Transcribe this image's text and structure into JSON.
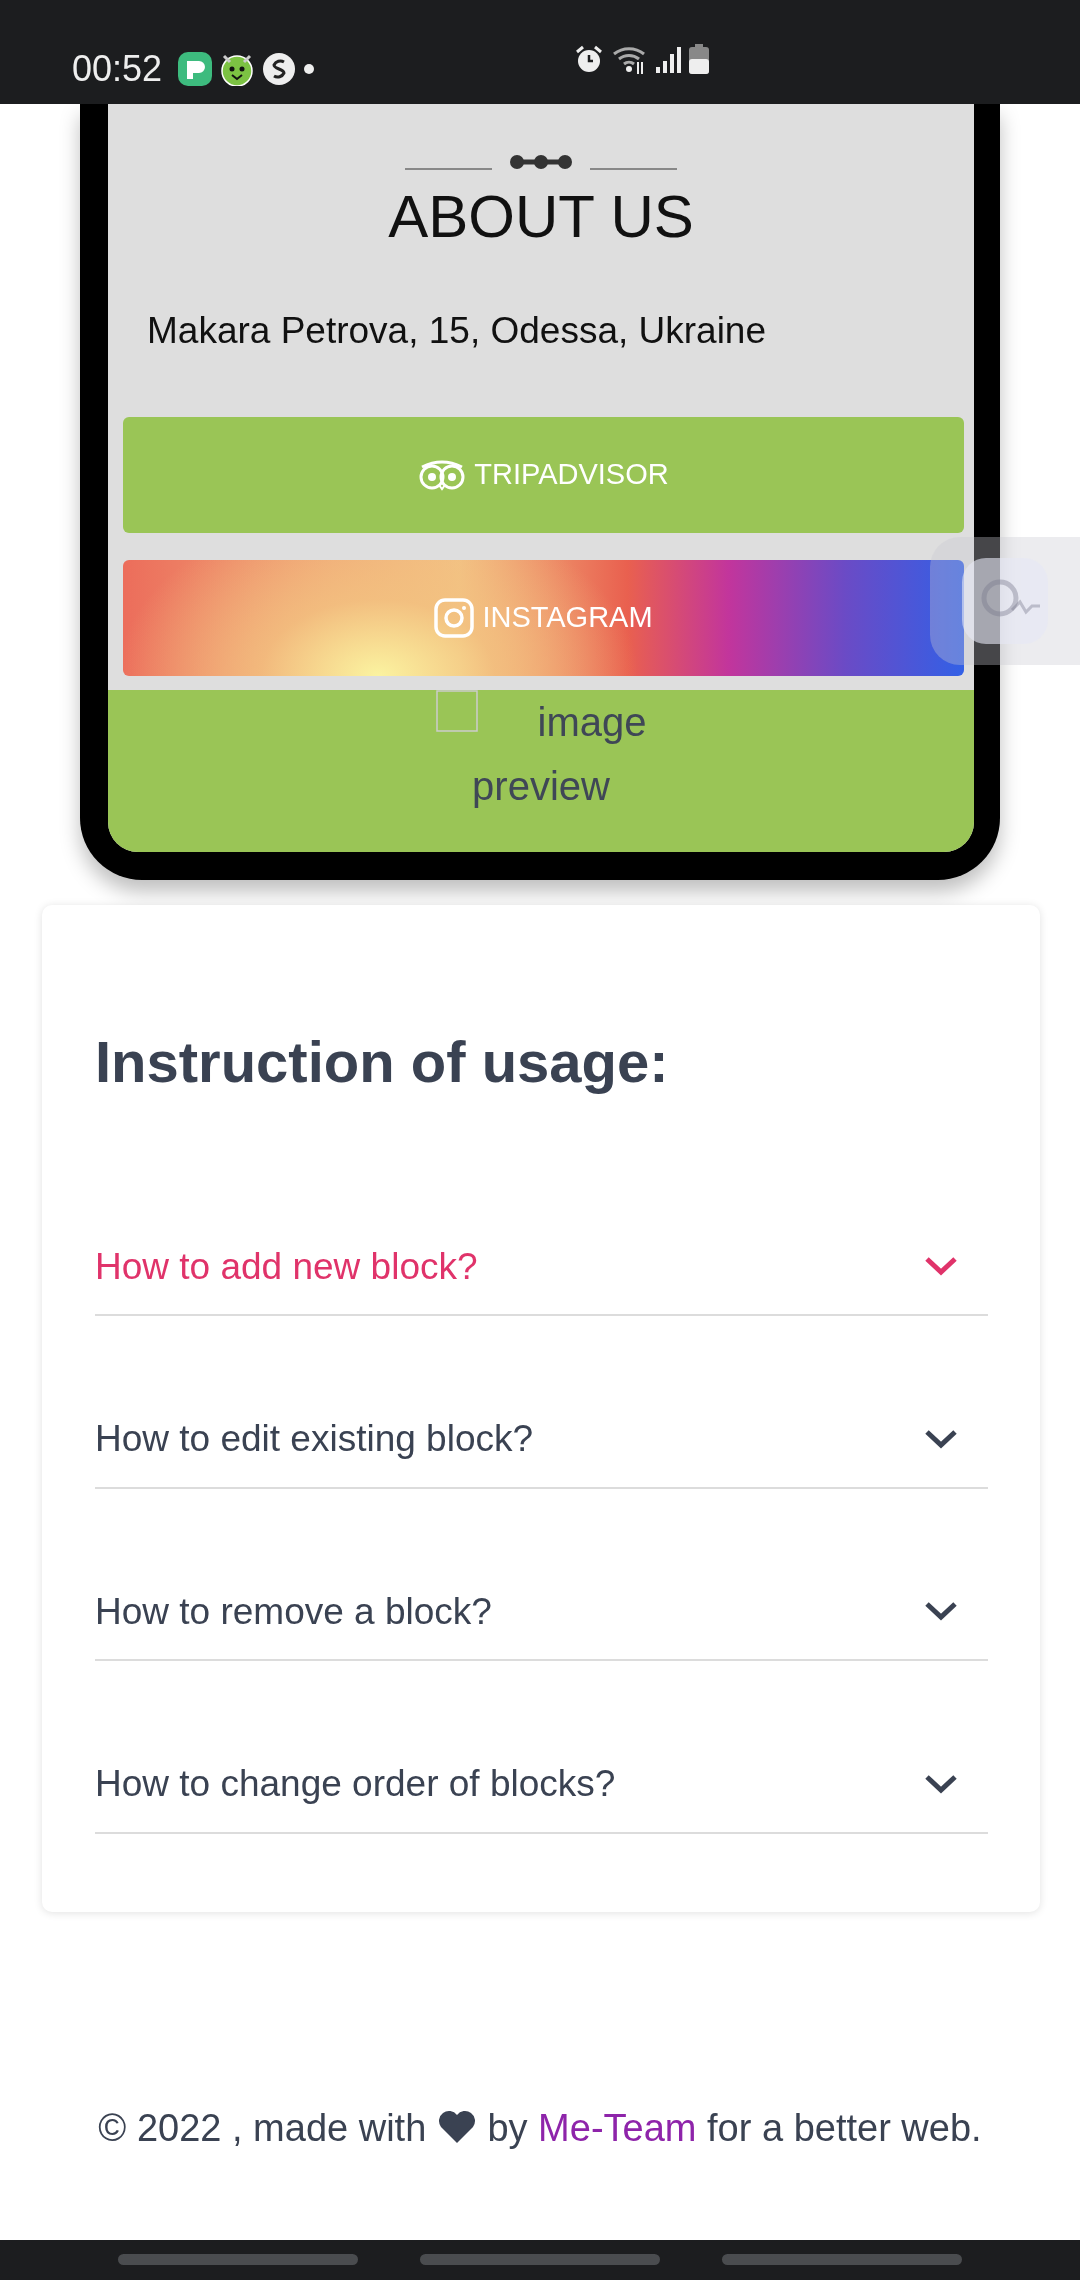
{
  "status_bar": {
    "time": "00:52"
  },
  "about": {
    "title": "ABOUT US",
    "address": "Makara Petrova, 15, Odessa, Ukraine",
    "buttons": [
      {
        "kind": "tripadvisor",
        "label": "TRIPADVISOR"
      },
      {
        "kind": "instagram",
        "label": "INSTAGRAM"
      }
    ],
    "image_alt": "image preview"
  },
  "instructions": {
    "title": "Instruction of usage:",
    "items": [
      {
        "question": "How to add new block?",
        "selected": true
      },
      {
        "question": "How to edit existing block?",
        "selected": false
      },
      {
        "question": "How to remove a block?",
        "selected": false
      },
      {
        "question": "How to change order of blocks?",
        "selected": false
      }
    ]
  },
  "footer": {
    "before": "© 2022 , made with",
    "by": "by",
    "link": "Me-Team",
    "after": "for a better web."
  }
}
